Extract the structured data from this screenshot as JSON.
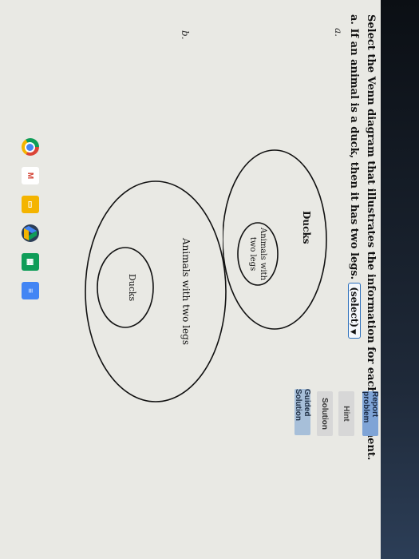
{
  "question": {
    "prompt": "Select the Venn diagram that illustrates the information for each statement.",
    "statement": "a. If an animal is a duck, then it has two legs.",
    "select_value": "(select)"
  },
  "options": [
    {
      "label": "a.",
      "outer_label": "Ducks",
      "inner_label_line1": "Animals with",
      "inner_label_line2": "two legs"
    },
    {
      "label": "b.",
      "outer_label": "Animals with two legs",
      "inner_label": "Ducks"
    }
  ],
  "buttons": {
    "report": "Report problem",
    "hint": "Hint",
    "solution": "Solution",
    "guided": "Guided Solution"
  },
  "taskbar_icons": [
    "chrome-icon",
    "gmail-icon",
    "slides-icon",
    "drive-icon",
    "sheets-icon",
    "docs-icon"
  ]
}
